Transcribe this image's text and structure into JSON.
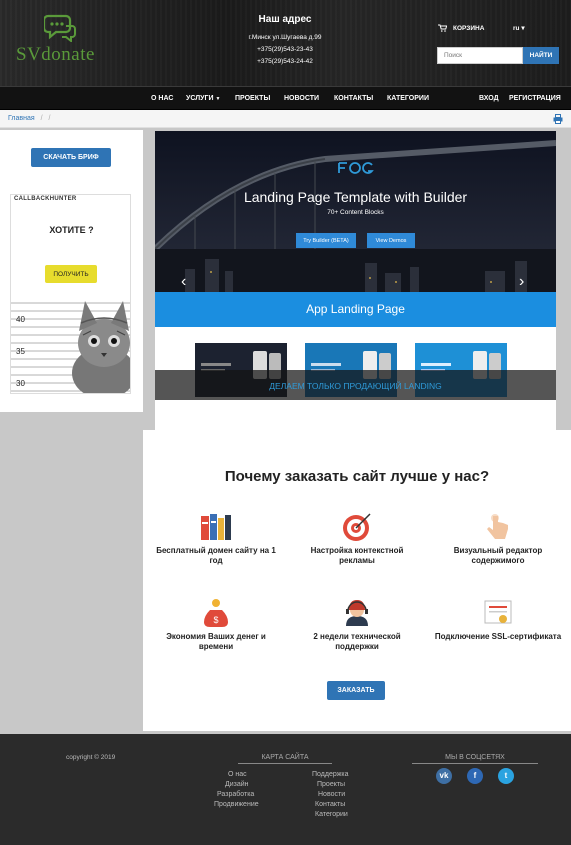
{
  "header": {
    "logo_text": "SVdonate",
    "address_title": "Наш адрес",
    "address_lines": [
      "г.Минск ул.Шугаева д.99",
      "+375(29)543-23-43",
      "+375(29)543-24-42"
    ],
    "cart_label": "КОРЗИНА",
    "language": "ru",
    "search_placeholder": "Поиск",
    "search_button": "НАЙТИ"
  },
  "nav": {
    "items": [
      "О НАС",
      "УСЛУГИ",
      "ПРОЕКТЫ",
      "НОВОСТИ",
      "КОНТАКТЫ",
      "КАТЕГОРИИ"
    ],
    "login": "ВХОД",
    "register": "РЕГИСТРАЦИЯ"
  },
  "breadcrumb": {
    "home": "Главная",
    "separator": "/"
  },
  "sidebar": {
    "brief_button": "СКАЧАТЬ БРИФ",
    "ad": {
      "brand": "CALLBACKHUNTER",
      "question": "ХОТИТЕ ?",
      "button": "ПОЛУЧИТЬ",
      "marks": [
        "40",
        "35",
        "30"
      ]
    }
  },
  "hero": {
    "title": "Landing Page Template with Builder",
    "subtitle": "70+ Content Blocks",
    "btn_try": "Try Builder (BETA)",
    "btn_demos": "View Demos",
    "band_title": "App Landing Page",
    "caption": "ДЕЛАЕМ ТОЛЬКО ПРОДАЮЩИЙ LANDING",
    "slides": 3,
    "active_slide": 2
  },
  "why": {
    "title": "Почему заказать сайт лучше у нас?",
    "features": [
      {
        "label": "Бесплатный домен сайту на 1 год",
        "icon": "books-icon"
      },
      {
        "label": "Настройка контекстной рекламы",
        "icon": "target-icon"
      },
      {
        "label": "Визуальный редактор содержимого",
        "icon": "pointer-hand-icon"
      },
      {
        "label": "Экономия Ваших денег и времени",
        "icon": "money-bag-icon"
      },
      {
        "label": "2 недели технической поддержки",
        "icon": "support-agent-icon"
      },
      {
        "label": "Подключение SSL-сертификата",
        "icon": "certificate-icon"
      }
    ],
    "order_button": "ЗАКАЗАТЬ"
  },
  "footer": {
    "copyright": "copyright © 2019",
    "sitemap_title": "КАРТА САЙТА",
    "sitemap_col1": [
      "О нас",
      "Дизайн",
      "Разработка",
      "Продвижение"
    ],
    "sitemap_col2": [
      "Поддержка",
      "Проекты",
      "Новости",
      "Контакты",
      "Категории"
    ],
    "social_title": "МЫ В СОЦСЕТЯХ",
    "social": [
      {
        "name": "vk",
        "glyph": "vk",
        "color": "#3e6fa4"
      },
      {
        "name": "facebook",
        "glyph": "f",
        "color": "#2e68b4"
      },
      {
        "name": "twitter",
        "glyph": "t",
        "color": "#2aa3e0"
      }
    ]
  }
}
